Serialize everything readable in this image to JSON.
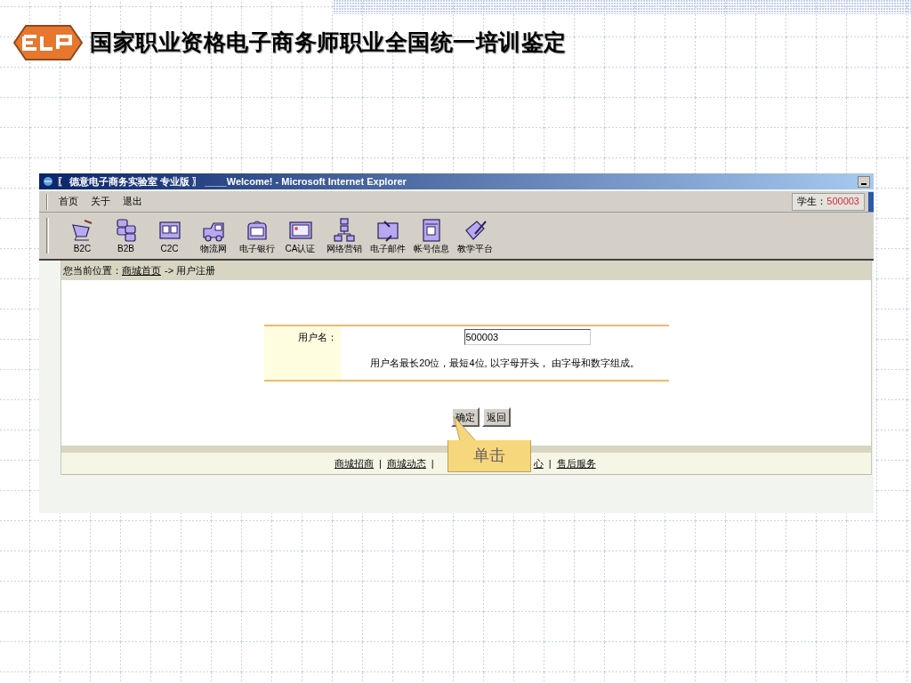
{
  "slide": {
    "title": "国家职业资格电子商务师职业全国统一培训鉴定"
  },
  "browser": {
    "title": "〖 德意电子商务实验室 专业版 〗 ____Welcome! - Microsoft Internet Explorer",
    "menu": [
      "首页",
      "关于",
      "退出"
    ],
    "user": {
      "label": "学生：",
      "id": "500003"
    },
    "toolbar": [
      {
        "kind": "cart",
        "label": "B2C"
      },
      {
        "kind": "servers",
        "label": "B2B"
      },
      {
        "kind": "folder",
        "label": "C2C"
      },
      {
        "kind": "truck",
        "label": "物流网"
      },
      {
        "kind": "bag",
        "label": "电子银行"
      },
      {
        "kind": "card",
        "label": "CA认证"
      },
      {
        "kind": "network",
        "label": "网络营销"
      },
      {
        "kind": "mail",
        "label": "电子邮件"
      },
      {
        "kind": "help",
        "label": "帐号信息"
      },
      {
        "kind": "pen",
        "label": "教学平台"
      }
    ],
    "breadcrumb": {
      "label": "您当前位置：",
      "link": "商城首页",
      "rest": "-> 用户注册"
    },
    "form": {
      "label": "用户名：",
      "value": "500003",
      "hint": "用户名最长20位，最短4位, 以字母开头， 由字母和数字组成。"
    },
    "buttons": [
      "确定",
      "返回"
    ],
    "footer": {
      "separator": "|",
      "links": [
        "商城招商",
        "商城动态",
        "心",
        "售后服务"
      ]
    }
  },
  "callout": {
    "text": "单击"
  }
}
